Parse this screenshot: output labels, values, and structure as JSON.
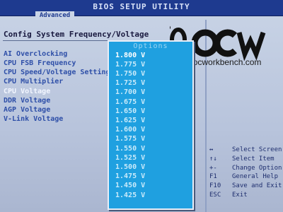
{
  "header": {
    "title": "BIOS SETUP UTILITY",
    "active_tab": "Advanced"
  },
  "main": {
    "section_title": "Config System Frequency/Voltage",
    "items": [
      {
        "label": "AI Overclocking"
      },
      {
        "label": "CPU FSB Frequency"
      },
      {
        "label": "CPU Speed/Voltage Setting"
      },
      {
        "label": "CPU Multiplier"
      },
      {
        "label": "CPU Voltage"
      },
      {
        "label": "DDR Voltage"
      },
      {
        "label": "AGP Voltage"
      },
      {
        "label": "V-Link Voltage"
      }
    ],
    "selected_index": 4
  },
  "popup": {
    "title": "Options",
    "options": [
      "1.800 V",
      "1.775 V",
      "1.750 V",
      "1.725 V",
      "1.700 V",
      "1.675 V",
      "1.650 V",
      "1.625 V",
      "1.600 V",
      "1.575 V",
      "1.550 V",
      "1.525 V",
      "1.500 V",
      "1.475 V",
      "1.450 V",
      "1.425 V"
    ],
    "highlighted_index": 0
  },
  "help": [
    {
      "key": "↔",
      "desc": "Select Screen"
    },
    {
      "key": "↑↓",
      "desc": "Select Item"
    },
    {
      "key": "+-",
      "desc": "Change Option"
    },
    {
      "key": "F1",
      "desc": "General Help"
    },
    {
      "key": "F10",
      "desc": "Save and Exit"
    },
    {
      "key": "ESC",
      "desc": "Exit"
    }
  ],
  "watermark": {
    "logo_text": "OCW",
    "url": "http://www.ocworkbench.com"
  },
  "colors": {
    "title_bar": "#1e3a8f",
    "popup_bg": "#1fa0e0",
    "screen_bg": "#c9d4e6",
    "item_text": "#2e4fa8"
  }
}
